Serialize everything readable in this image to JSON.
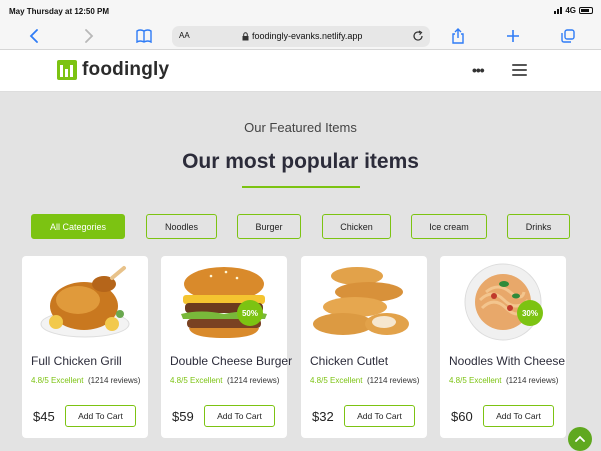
{
  "status": {
    "time": "May Thursday at 12:50 PM",
    "network": "4G"
  },
  "browser": {
    "text_size": "AA",
    "url": "foodingly-evanks.netlify.app"
  },
  "header": {
    "logo_text": "foodingly"
  },
  "section": {
    "subtitle": "Our Featured Items",
    "title": "Our most popular items"
  },
  "categories": [
    "All Categories",
    "Noodles",
    "Burger",
    "Chicken",
    "Ice cream",
    "Drinks"
  ],
  "active_category": "All Categories",
  "products": [
    {
      "name": "Full Chicken Grill",
      "score": "4.8/5 Excellent",
      "reviews": "(1214 reviews)",
      "price": "$45",
      "button": "Add To Cart",
      "badge": ""
    },
    {
      "name": "Double Cheese Burger",
      "score": "4.8/5 Excellent",
      "reviews": "(1214 reviews)",
      "price": "$59",
      "button": "Add To Cart",
      "badge": "50%"
    },
    {
      "name": "Chicken Cutlet",
      "score": "4.8/5 Excellent",
      "reviews": "(1214 reviews)",
      "price": "$32",
      "button": "Add To Cart",
      "badge": ""
    },
    {
      "name": "Noodles With Cheese",
      "score": "4.8/5 Excellent",
      "reviews": "(1214 reviews)",
      "price": "$60",
      "button": "Add To Cart",
      "badge": "30%"
    }
  ],
  "colors": {
    "accent": "#7cc312",
    "background": "#e3e3e3",
    "card": "#ffffff",
    "browser_blue": "#2f7cf6"
  }
}
